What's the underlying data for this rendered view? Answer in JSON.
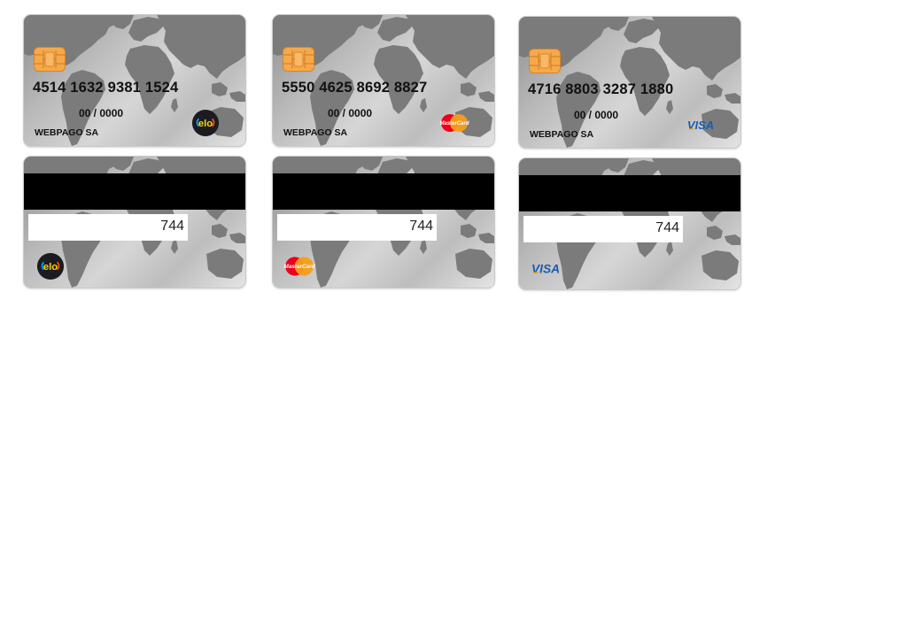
{
  "cards": [
    {
      "brand": "elo",
      "number": "4514 1632 9381 1524",
      "expiry": "00 / 0000",
      "holder": "WEBPAGO SA",
      "cvv": "744",
      "brand_label": "elo"
    },
    {
      "brand": "mastercard",
      "number": "5550 4625 8692 8827",
      "expiry": "00 / 0000",
      "holder": "WEBPAGO SA",
      "cvv": "744",
      "brand_label": "MasterCard"
    },
    {
      "brand": "visa",
      "number": "4716 8803 3287 1880",
      "expiry": "00 / 0000",
      "holder": "WEBPAGO SA",
      "cvv": "744",
      "brand_label": "VISA"
    }
  ],
  "colors": {
    "chip": "#f7a94a",
    "elo_bg": "#1d1b22",
    "elo_yellow": "#ffd200",
    "mc_red": "#eb001b",
    "mc_orange": "#f79e1b",
    "visa_blue": "#1a5cb0"
  }
}
